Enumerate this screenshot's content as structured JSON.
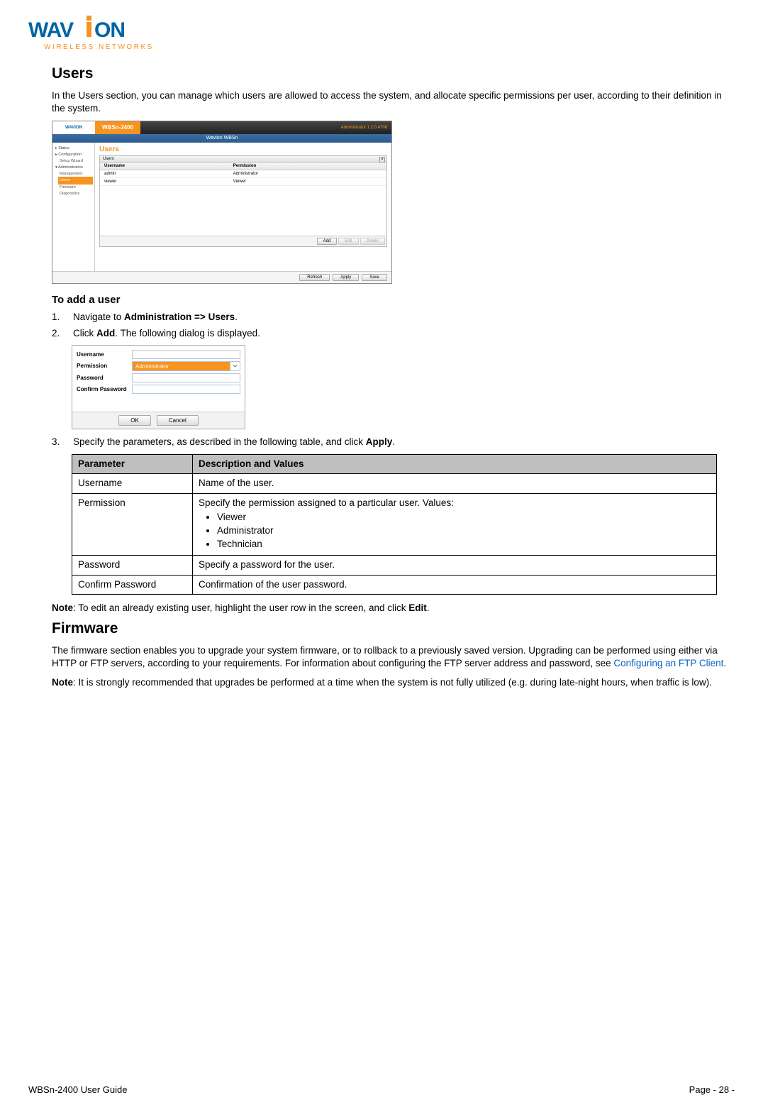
{
  "logo": {
    "primary": "WAV",
    "accent": "I",
    "suffix": "ON",
    "tagline": "WIRELESS NETWORKS"
  },
  "users": {
    "heading": "Users",
    "intro": "In the Users section, you can manage which users are allowed to access the system, and allocate specific permissions per user, according to their definition in the system."
  },
  "shot1": {
    "logo": "WAVION",
    "breadcrumb": "WBSn-2400",
    "admin_info": "Administrator 1.2.0.4708",
    "bluebar": "Wavion WBSn",
    "sidebar": [
      {
        "label": "Status",
        "sub": false
      },
      {
        "label": "Configuration",
        "sub": false
      },
      {
        "label": "Setup Wizard",
        "sub": true
      },
      {
        "label": "Administration",
        "sub": false
      },
      {
        "label": "Management",
        "sub": true
      },
      {
        "label": "Users",
        "sub": true,
        "selected": true
      },
      {
        "label": "Firmware",
        "sub": true
      },
      {
        "label": "Diagnostics",
        "sub": true
      }
    ],
    "panel_title": "Users",
    "cols": {
      "username": "Username",
      "permission": "Permission"
    },
    "rows": [
      {
        "u": "admin",
        "p": "Administrator"
      },
      {
        "u": "viewer",
        "p": "Viewer"
      }
    ],
    "panel_btns": {
      "add": "Add",
      "edit": "Edit",
      "delete": "Delete"
    },
    "foot_btns": {
      "refresh": "Refresh",
      "apply": "Apply",
      "save": "Save"
    }
  },
  "add_user": {
    "heading": "To add a user",
    "steps": {
      "s1_pre": "Navigate to ",
      "s1_bold": "Administration => Users",
      "s1_post": ".",
      "s2_pre": "Click ",
      "s2_bold": "Add",
      "s2_post": ". The following dialog is displayed.",
      "s3_pre": "Specify the parameters, as described in the following table, and click ",
      "s3_bold": "Apply",
      "s3_post": "."
    }
  },
  "shot2": {
    "labels": {
      "username": "Username",
      "permission": "Permission",
      "password": "Password",
      "confirm": "Confirm Password"
    },
    "selected_permission": "Administrator",
    "buttons": {
      "ok": "OK",
      "cancel": "Cancel"
    }
  },
  "param_table": {
    "heads": {
      "param": "Parameter",
      "desc": "Description and Values"
    },
    "rows": {
      "username": {
        "p": "Username",
        "d": "Name of the user."
      },
      "permission": {
        "p": "Permission",
        "d_intro": "Specify the permission assigned to a particular user. Values:",
        "values": [
          "Viewer",
          "Administrator",
          "Technician"
        ]
      },
      "password": {
        "p": "Password",
        "d": "Specify a password for the user."
      },
      "confirm": {
        "p": "Confirm Password",
        "d": "Confirmation of the user password."
      }
    }
  },
  "note1": {
    "label": "Note",
    "pre": ": To edit an already existing user, highlight the user row in the screen, and click ",
    "bold": "Edit",
    "post": "."
  },
  "firmware": {
    "heading": "Firmware",
    "body_pre": "The firmware section enables you to upgrade your system firmware, or to rollback to a previously saved version. Upgrading can be performed using either via HTTP or FTP servers, according to your requirements. For information about configuring the FTP server address and password, see ",
    "link": "Configuring an FTP Client",
    "body_post": "."
  },
  "note2": {
    "label": "Note",
    "text": ": It is strongly recommended that upgrades be performed at a time when the system is not fully utilized (e.g. during late-night hours, when traffic is low)."
  },
  "footer": {
    "left": "WBSn-2400 User Guide",
    "right": "Page - 28 -"
  }
}
